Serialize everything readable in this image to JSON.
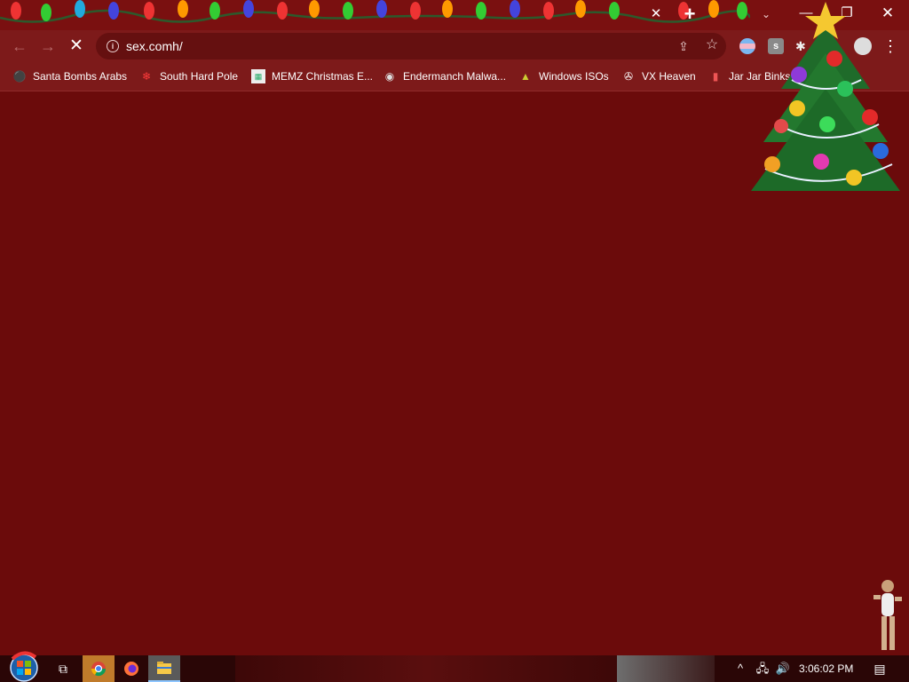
{
  "browser": {
    "tab_close_glyph": "✕",
    "new_tab_glyph": "+",
    "tab_search_glyph": "⌄",
    "window_controls": {
      "minimize": "—",
      "maximize": "❐",
      "close": "✕"
    }
  },
  "toolbar": {
    "back_glyph": "←",
    "forward_glyph": "→",
    "stop_glyph": "✕",
    "url": "sex.comh/",
    "share_glyph": "⇪",
    "bookmark_star_glyph": "☆",
    "menu_glyph": "⋮",
    "extension_2_label": "s"
  },
  "bookmarks": [
    {
      "label": "Santa Bombs Arabs",
      "icon": "santa-icon"
    },
    {
      "label": "South Hard Pole",
      "icon": "snowflake-icon"
    },
    {
      "label": "MEMZ Christmas E...",
      "icon": "memz-icon"
    },
    {
      "label": "Endermanch Malwa...",
      "icon": "raccoon-icon"
    },
    {
      "label": "Windows ISOs",
      "icon": "tree-icon"
    },
    {
      "label": "VX Heaven",
      "icon": "vx-icon"
    },
    {
      "label": "Jar Jar Binks",
      "icon": "jarjar-icon"
    }
  ],
  "taskbar": {
    "task_view_glyph": "⧉",
    "tray_up_glyph": "^",
    "clock": "3:06:02 PM",
    "notification_glyph": "▤"
  },
  "colors": {
    "page_background": "#6b0b0b",
    "toolbar": "#7d1a1a",
    "tabstrip": "#7a1010",
    "taskbar": "#2a0606"
  }
}
